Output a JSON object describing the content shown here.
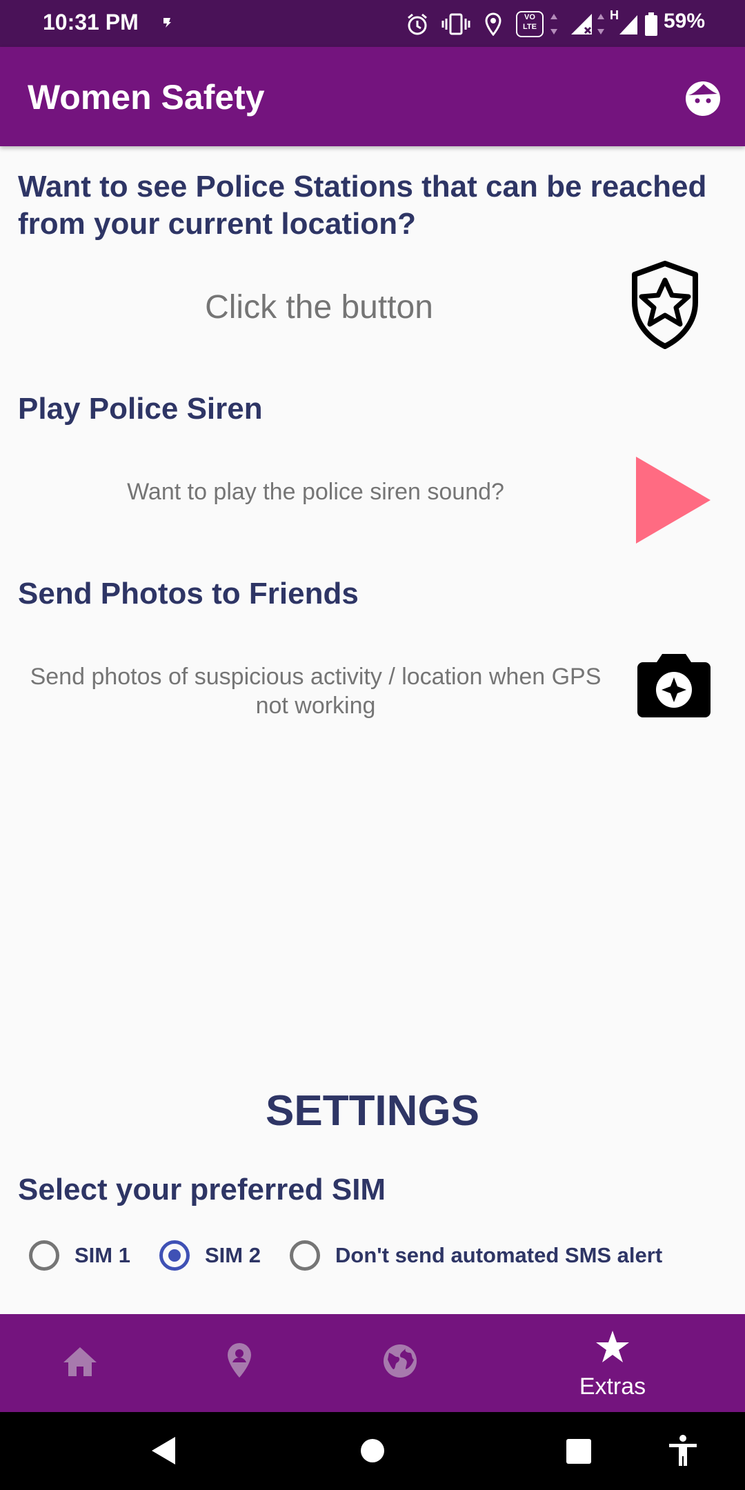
{
  "status_bar": {
    "time": "10:31 PM",
    "battery": "59%",
    "network_type": "H",
    "volte": "VO LTE"
  },
  "app_bar": {
    "title": "Women Safety",
    "profile_icon": "face-icon"
  },
  "police_stations": {
    "title": "Want to see Police Stations that can be reached from your current location?",
    "description": "Click the button",
    "button_icon": "police-badge-icon"
  },
  "siren": {
    "title": "Play Police Siren",
    "description": "Want to play the police siren sound?",
    "button_icon": "play-icon",
    "button_color": "#ff6b82"
  },
  "photos": {
    "title": "Send Photos to Friends",
    "description": "Send photos of suspicious activity / location when GPS not working",
    "button_icon": "camera-icon"
  },
  "settings": {
    "title": "SETTINGS",
    "sim_title": "Select your preferred SIM",
    "options": [
      {
        "label": "SIM 1",
        "checked": false
      },
      {
        "label": "SIM 2",
        "checked": true
      },
      {
        "label": "Don't send automated SMS alert",
        "checked": false
      }
    ]
  },
  "bottom_nav": {
    "items": [
      {
        "icon": "home-icon",
        "label": ""
      },
      {
        "icon": "location-pin-icon",
        "label": ""
      },
      {
        "icon": "globe-icon",
        "label": ""
      },
      {
        "icon": "star-icon",
        "label": "Extras",
        "active": true
      }
    ]
  },
  "colors": {
    "primary": "#74147e",
    "status_bar": "#4a1258",
    "heading": "#2e3565",
    "radio_accent": "#3f51b5"
  }
}
